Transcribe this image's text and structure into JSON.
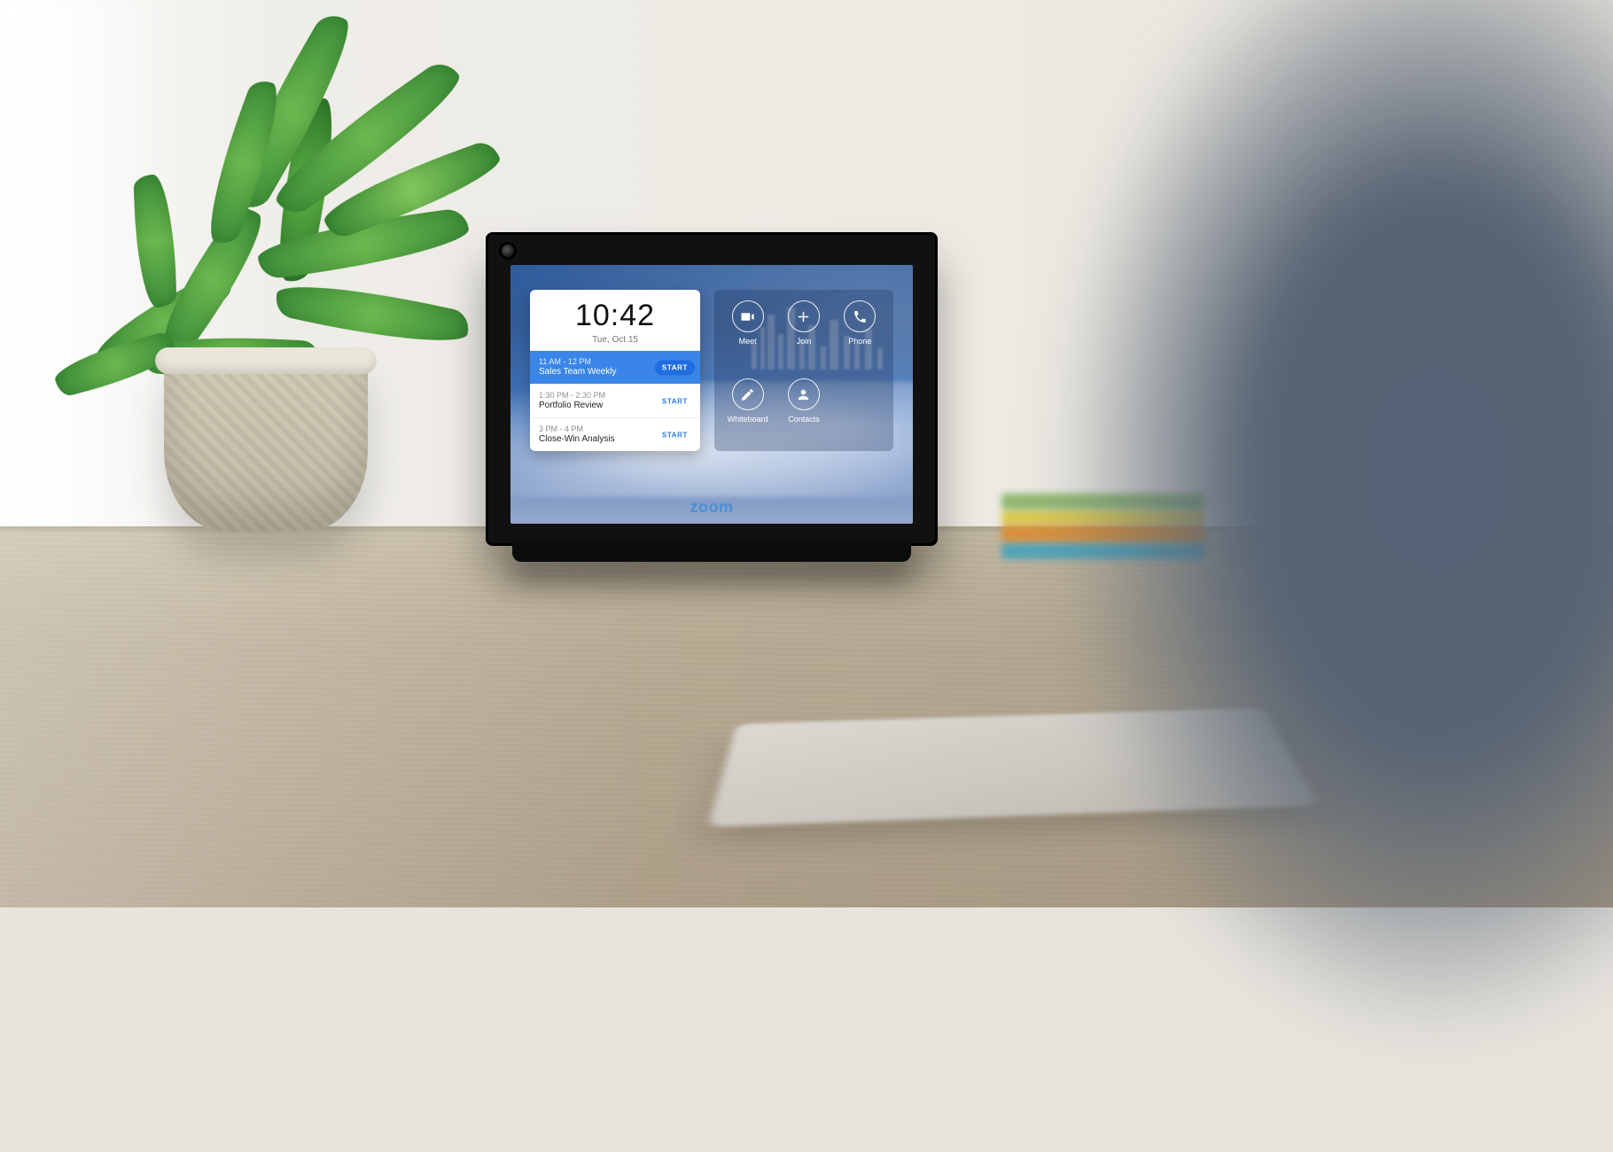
{
  "device": {
    "brand": "zoom",
    "clock": {
      "time": "10:42",
      "date": "Tue, Oct 15"
    },
    "schedule": [
      {
        "timerange": "11 AM - 12 PM",
        "title": "Sales Team Weekly",
        "button": "START",
        "active": true
      },
      {
        "timerange": "1:30 PM - 2:30 PM",
        "title": "Portfolio Review",
        "button": "START",
        "active": false
      },
      {
        "timerange": "3 PM - 4 PM",
        "title": "Close-Win Analysis",
        "button": "START",
        "active": false
      }
    ],
    "actions": [
      {
        "key": "meet",
        "label": "Meet",
        "icon": "video-icon"
      },
      {
        "key": "join",
        "label": "Join",
        "icon": "plus-icon"
      },
      {
        "key": "phone",
        "label": "Phone",
        "icon": "phone-icon"
      },
      {
        "key": "whiteboard",
        "label": "Whiteboard",
        "icon": "pencil-icon"
      },
      {
        "key": "contacts",
        "label": "Contacts",
        "icon": "person-icon"
      }
    ]
  }
}
